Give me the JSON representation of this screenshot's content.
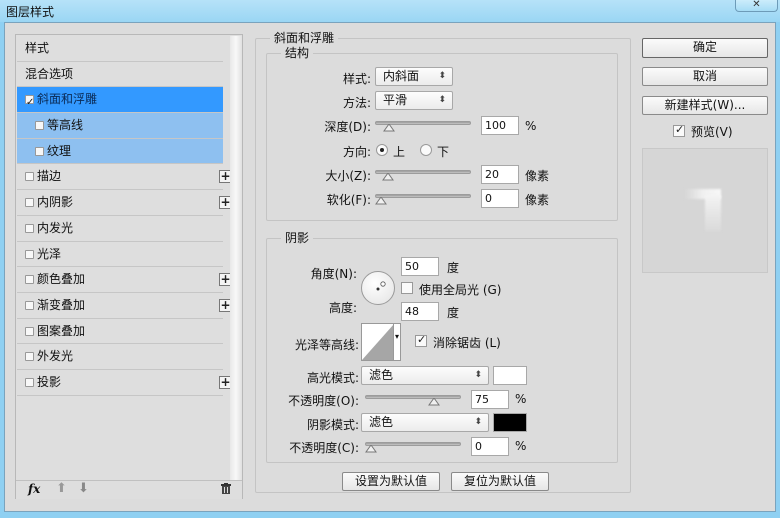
{
  "window": {
    "title": "图层样式",
    "close_icon": "close-x"
  },
  "sidebar": {
    "header": "样式",
    "items": [
      {
        "label": "混合选项",
        "checkbox": false,
        "checked": false,
        "plus": false,
        "state": "normal"
      },
      {
        "label": "斜面和浮雕",
        "checkbox": true,
        "checked": true,
        "plus": false,
        "state": "selected"
      },
      {
        "label": "等高线",
        "checkbox": true,
        "checked": false,
        "plus": false,
        "state": "sub"
      },
      {
        "label": "纹理",
        "checkbox": true,
        "checked": false,
        "plus": false,
        "state": "sub"
      },
      {
        "label": "描边",
        "checkbox": true,
        "checked": false,
        "plus": true,
        "state": "normal"
      },
      {
        "label": "内阴影",
        "checkbox": true,
        "checked": false,
        "plus": true,
        "state": "normal"
      },
      {
        "label": "内发光",
        "checkbox": true,
        "checked": false,
        "plus": false,
        "state": "normal"
      },
      {
        "label": "光泽",
        "checkbox": true,
        "checked": false,
        "plus": false,
        "state": "normal"
      },
      {
        "label": "颜色叠加",
        "checkbox": true,
        "checked": false,
        "plus": true,
        "state": "normal"
      },
      {
        "label": "渐变叠加",
        "checkbox": true,
        "checked": false,
        "plus": true,
        "state": "normal"
      },
      {
        "label": "图案叠加",
        "checkbox": true,
        "checked": false,
        "plus": false,
        "state": "normal"
      },
      {
        "label": "外发光",
        "checkbox": true,
        "checked": false,
        "plus": false,
        "state": "normal"
      },
      {
        "label": "投影",
        "checkbox": true,
        "checked": false,
        "plus": true,
        "state": "normal"
      }
    ],
    "footer": {
      "fx_label": "fx",
      "icons": [
        "fx-icon",
        "move-up-icon",
        "move-down-icon",
        "trash-icon"
      ]
    }
  },
  "bevel": {
    "section_title": "斜面和浮雕",
    "structure": {
      "title": "结构",
      "style_label": "样式:",
      "style_value": "内斜面",
      "technique_label": "方法:",
      "technique_value": "平滑",
      "depth_label": "深度(D):",
      "depth_value": "100",
      "depth_unit": "%",
      "depth_slider": 0.1,
      "direction_label": "方向:",
      "direction_up": "上",
      "direction_down": "下",
      "direction_selected": "上",
      "size_label": "大小(Z):",
      "size_value": "20",
      "size_unit": "像素",
      "size_slider": 0.08,
      "soften_label": "软化(F):",
      "soften_value": "0",
      "soften_unit": "像素",
      "soften_slider": 0.0
    },
    "shading": {
      "title": "阴影",
      "angle_label": "角度(N):",
      "angle_value": "50",
      "angle_unit": "度",
      "global_light_label": "使用全局光 (G)",
      "global_light_checked": false,
      "altitude_label": "高度:",
      "altitude_value": "48",
      "altitude_unit": "度",
      "gloss_contour_label": "光泽等高线:",
      "anti_alias_label": "消除锯齿 (L)",
      "anti_alias_checked": true,
      "highlight_mode_label": "高光模式:",
      "highlight_mode_value": "滤色",
      "highlight_color": "#ffffff",
      "highlight_opacity_label": "不透明度(O):",
      "highlight_opacity_value": "75",
      "highlight_opacity_unit": "%",
      "highlight_opacity_slider": 0.75,
      "shadow_mode_label": "阴影模式:",
      "shadow_mode_value": "滤色",
      "shadow_color": "#000000",
      "shadow_opacity_label": "不透明度(C):",
      "shadow_opacity_value": "0",
      "shadow_opacity_unit": "%",
      "shadow_opacity_slider": 0.0
    },
    "make_default": "设置为默认值",
    "reset_default": "复位为默认值"
  },
  "actions": {
    "ok": "确定",
    "cancel": "取消",
    "new_style": "新建样式(W)...",
    "preview_label": "预览(V)",
    "preview_checked": true
  }
}
